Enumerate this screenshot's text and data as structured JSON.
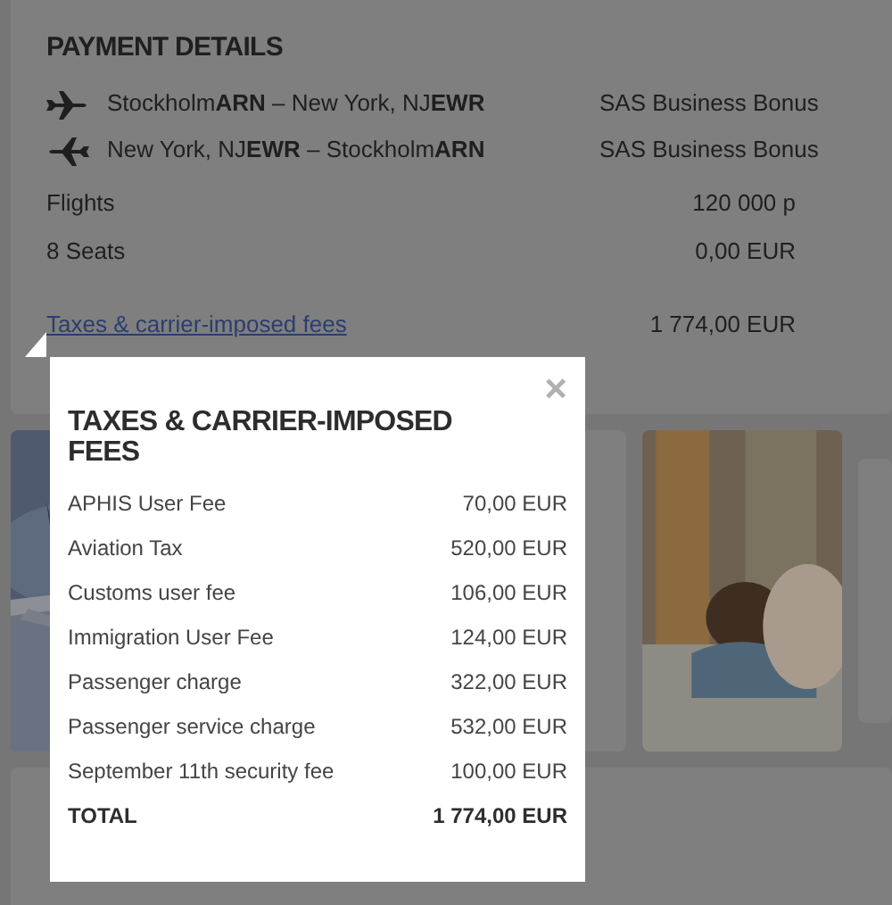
{
  "payment_details": {
    "title": "PAYMENT DETAILS",
    "routes": [
      {
        "kind": "outbound",
        "route": "Stockholm**ARN** – New York, NJ**EWR**",
        "fare": "SAS Business Bonus"
      },
      {
        "kind": "return",
        "route": "New York, NJ**EWR** – Stockholm**ARN**",
        "fare": "SAS Business Bonus"
      }
    ],
    "lines": [
      {
        "label": "Flights",
        "amount": "120 000 p"
      },
      {
        "label": "8 Seats",
        "amount": "0,00 EUR"
      }
    ],
    "fees_link": {
      "label": "Taxes & carrier-imposed fees",
      "amount": "1 774,00 EUR"
    }
  },
  "fees_popup": {
    "close": "×",
    "title": "TAXES & CARRIER-IMPOSED FEES",
    "items": [
      {
        "label": "APHIS User Fee",
        "amount": "70,00 EUR"
      },
      {
        "label": "Aviation Tax",
        "amount": "520,00 EUR"
      },
      {
        "label": "Customs user fee",
        "amount": "106,00 EUR"
      },
      {
        "label": "Immigration User Fee",
        "amount": "124,00 EUR"
      },
      {
        "label": "Passenger charge",
        "amount": "322,00 EUR"
      },
      {
        "label": "Passenger service charge",
        "amount": "532,00 EUR"
      },
      {
        "label": "September 11th security fee",
        "amount": "100,00 EUR"
      }
    ],
    "total": {
      "label": "TOTAL",
      "amount": "1 774,00 EUR"
    }
  }
}
